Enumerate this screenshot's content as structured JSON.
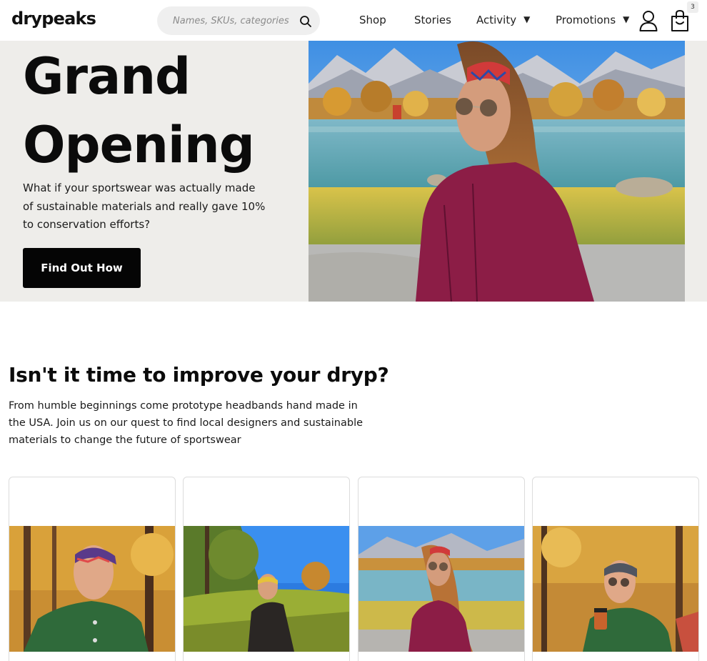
{
  "header": {
    "logo": "drypeaks",
    "search_placeholder": "Names, SKUs, categories",
    "nav": [
      {
        "label": "Shop"
      },
      {
        "label": "Stories"
      },
      {
        "label": "Activity",
        "dropdown": "▼"
      },
      {
        "label": "Promotions",
        "dropdown": "▼"
      }
    ],
    "cart_count": "3",
    "icons": {
      "search": "search-icon",
      "account": "user-icon",
      "cart": "shopping-bag-icon"
    }
  },
  "hero": {
    "title_line1": "Grand",
    "title_line2": "Opening",
    "text": "What if your sportswear was actually made of sustainable materials and really gave 10% to conservation efforts?",
    "button_label": "Find Out How"
  },
  "intro": {
    "title": "Isn't it time to improve your dryp?",
    "text": "From humble beginnings come prototype headbands hand made in the USA. Join us on our quest to find local designers and sustainable materials to change the future of sportswear"
  },
  "colors": {
    "hero_bg": "#eeedea",
    "button_bg": "#050505",
    "jacket_magenta": "#8c1d46",
    "jacket_green": "#2f6a3a",
    "autumn_gold": "#d9a13a"
  }
}
